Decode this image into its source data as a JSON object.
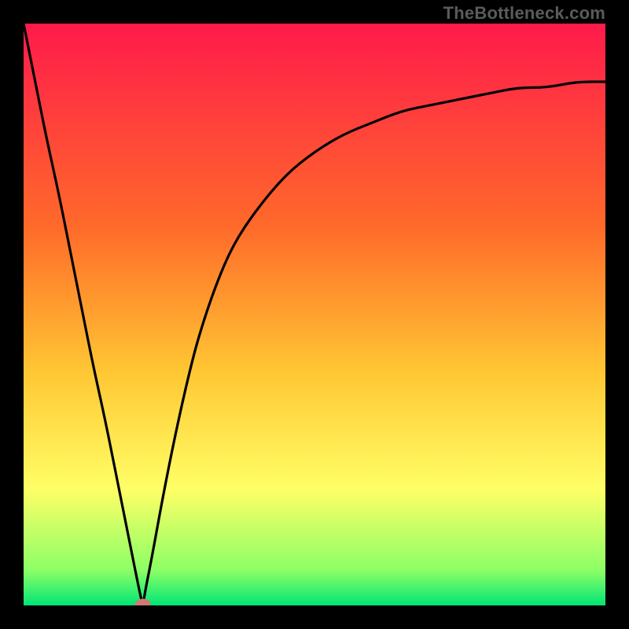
{
  "watermark": "TheBottleneck.com",
  "chart_data": {
    "type": "line",
    "title": "",
    "xlabel": "",
    "ylabel": "",
    "xlim": [
      0,
      1
    ],
    "ylim": [
      0,
      1
    ],
    "x": [
      0.0,
      0.02,
      0.04,
      0.06,
      0.08,
      0.1,
      0.12,
      0.14,
      0.16,
      0.18,
      0.2,
      0.205,
      0.21,
      0.22,
      0.24,
      0.26,
      0.28,
      0.3,
      0.33,
      0.36,
      0.4,
      0.45,
      0.5,
      0.55,
      0.6,
      0.65,
      0.7,
      0.75,
      0.8,
      0.85,
      0.9,
      0.95,
      1.0
    ],
    "y": [
      1.0,
      0.9,
      0.8,
      0.71,
      0.61,
      0.51,
      0.41,
      0.32,
      0.22,
      0.12,
      0.02,
      0.0,
      0.03,
      0.08,
      0.19,
      0.29,
      0.38,
      0.46,
      0.55,
      0.62,
      0.68,
      0.74,
      0.78,
      0.81,
      0.83,
      0.85,
      0.86,
      0.87,
      0.88,
      0.89,
      0.89,
      0.9,
      0.9
    ],
    "gradient_colors": [
      "#ff1a4b",
      "#ff6a2a",
      "#ffc733",
      "#ffff66",
      "#8cff66",
      "#00e676"
    ],
    "marker": {
      "x": 0.205,
      "y": 0.002,
      "label": "bottleneck-point"
    }
  }
}
